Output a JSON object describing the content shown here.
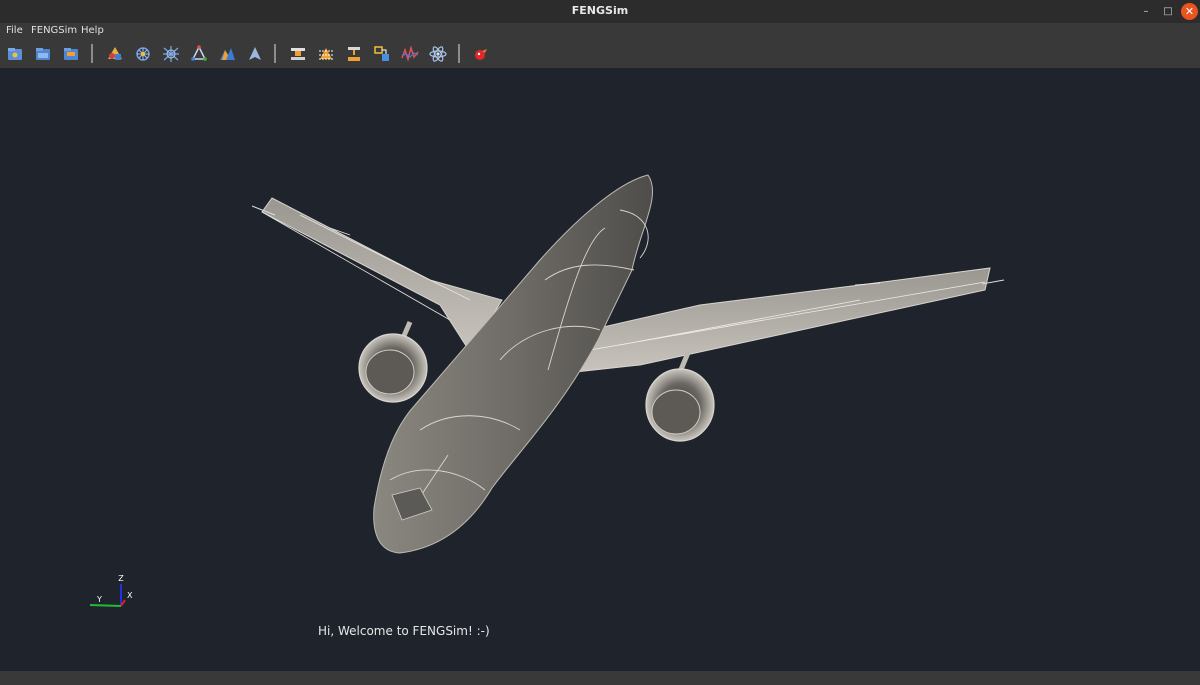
{
  "window": {
    "title": "FENGSim"
  },
  "menu": {
    "items": [
      "File",
      "FENGSim",
      "Help"
    ]
  },
  "toolbar": {
    "file_group": [
      "new-icon",
      "open-icon",
      "save-icon"
    ],
    "modules_group": [
      "cad-icon",
      "mesh-icon",
      "solver-icon",
      "geometry-icon",
      "visualization-icon",
      "arrow-icon"
    ],
    "process_group": [
      "machining-icon",
      "slicing-icon",
      "additive-icon",
      "assembly-icon",
      "analysis-icon",
      "atom-icon"
    ],
    "extra_group": [
      "dragon-icon"
    ]
  },
  "axes": {
    "z": "Z",
    "y": "Y",
    "x": "X"
  },
  "welcome": "Hi, Welcome to FENGSim! :-)"
}
